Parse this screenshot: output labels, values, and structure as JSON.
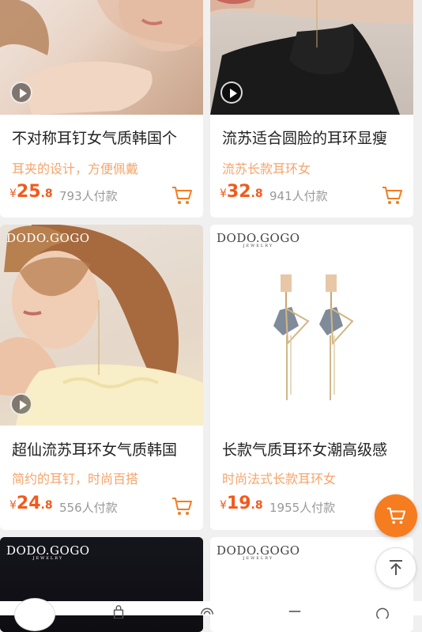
{
  "products": [
    {
      "title": "不对称耳钉女气质韩国个",
      "subtitle": "耳夹的设计，方便佩戴",
      "price_int": "25",
      "price_dec": ".8",
      "buyers": "793人付款",
      "has_video": true
    },
    {
      "title": "流苏适合圆脸的耳环显瘦",
      "subtitle": "流苏长款耳环女",
      "price_int": "32",
      "price_dec": ".8",
      "buyers": "941人付款",
      "has_video": true
    },
    {
      "title": "超仙流苏耳环女气质韩国",
      "subtitle": "简约的耳钉，时尚百搭",
      "price_int": "24",
      "price_dec": ".8",
      "buyers": "556人付款",
      "has_video": true,
      "brand": "DODO.GOGO"
    },
    {
      "title": "长款气质耳环女潮高级感",
      "subtitle": "时尚法式长款耳环女",
      "price_int": "19",
      "price_dec": ".8",
      "buyers": "1955人付款",
      "has_video": false,
      "brand": "DODO.GOGO",
      "brand_sub": "JEWELRY"
    },
    {
      "brand": "DODO.GOGO",
      "brand_sub": "JEWELRY"
    },
    {
      "brand": "DODO.GOGO",
      "brand_sub": "JEWELRY"
    }
  ],
  "currency_symbol": "¥",
  "icons": {
    "cart": "cart-icon",
    "play": "play-icon",
    "back_to_top": "arrow-up-icon",
    "floating_cart": "cart-icon"
  },
  "colors": {
    "price": "#f25a1c",
    "subtitle": "#f6a46b",
    "cart_button": "#f57c1f",
    "background": "#f0f0f0"
  }
}
